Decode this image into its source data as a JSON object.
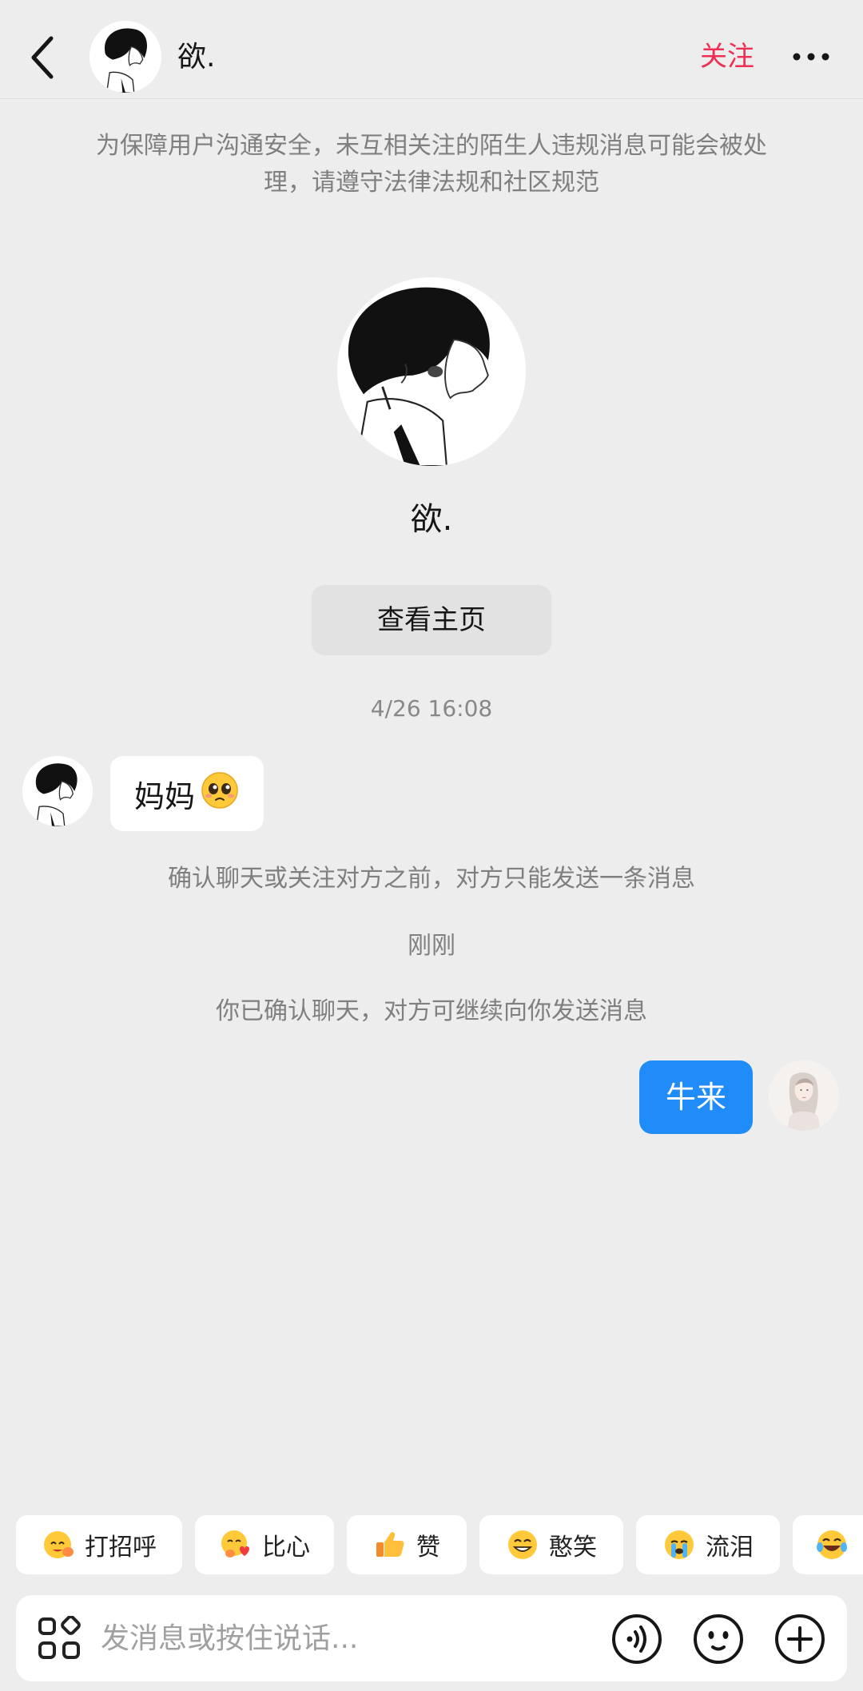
{
  "header": {
    "name": "欲.",
    "follow_label": "关注"
  },
  "notice": "为保障用户沟通安全，未互相关注的陌生人违规消息可能会被处理，请遵守法律法规和社区规范",
  "profile": {
    "name": "欲.",
    "view_profile_label": "查看主页"
  },
  "chat": {
    "timestamp": "4/26 16:08",
    "incoming_message": "妈妈",
    "incoming_emoji": "pleading-face",
    "system_notice_1": "确认聊天或关注对方之前，对方只能发送一条消息",
    "time_just_now": "刚刚",
    "system_notice_2": "你已确认聊天，对方可继续向你发送消息",
    "outgoing_message": "牛来"
  },
  "quick_replies": [
    {
      "label": "打招呼",
      "icon": "wave-hand-face-icon"
    },
    {
      "label": "比心",
      "icon": "heart-hands-face-icon"
    },
    {
      "label": "赞",
      "icon": "thumbs-up-icon"
    },
    {
      "label": "憨笑",
      "icon": "grin-face-icon"
    },
    {
      "label": "流泪",
      "icon": "crying-face-icon"
    },
    {
      "label": "",
      "icon": "laughing-tears-face-icon"
    }
  ],
  "input": {
    "placeholder": "发消息或按住说话..."
  },
  "colors": {
    "accent_follow": "#ee2f53",
    "outgoing_bubble": "#1f8cf9",
    "background": "#ededed"
  }
}
